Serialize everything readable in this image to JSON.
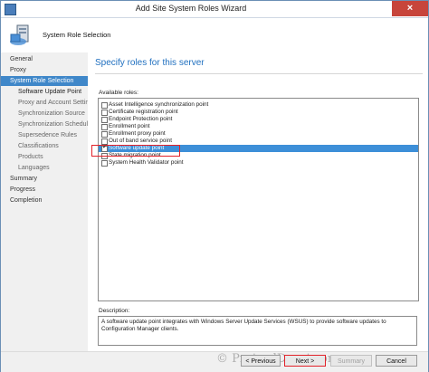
{
  "window": {
    "title": "Add Site System Roles Wizard",
    "close_glyph": "×"
  },
  "header": {
    "title": "System Role Selection"
  },
  "nav": {
    "items": [
      {
        "label": "General",
        "level": 0,
        "selected": false
      },
      {
        "label": "Proxy",
        "level": 0,
        "selected": false
      },
      {
        "label": "System Role Selection",
        "level": 0,
        "selected": true
      },
      {
        "label": "Software Update Point",
        "level": 1,
        "selected": false
      },
      {
        "label": "Proxy and Account Settin",
        "level": 1,
        "selected": false
      },
      {
        "label": "Synchronization Source",
        "level": 1,
        "selected": false
      },
      {
        "label": "Synchronization Schedule",
        "level": 1,
        "selected": false
      },
      {
        "label": "Supersedence Rules",
        "level": 1,
        "selected": false
      },
      {
        "label": "Classifications",
        "level": 1,
        "selected": false
      },
      {
        "label": "Products",
        "level": 1,
        "selected": false
      },
      {
        "label": "Languages",
        "level": 1,
        "selected": false
      },
      {
        "label": "Summary",
        "level": 0,
        "selected": false
      },
      {
        "label": "Progress",
        "level": 0,
        "selected": false
      },
      {
        "label": "Completion",
        "level": 0,
        "selected": false
      }
    ]
  },
  "content": {
    "heading": "Specify roles for this server",
    "available_label": "Available roles:",
    "roles": [
      {
        "label": "Asset Intelligence synchronization point",
        "checked": false,
        "selected": false
      },
      {
        "label": "Certificate registration point",
        "checked": false,
        "selected": false
      },
      {
        "label": "Endpoint Protection point",
        "checked": false,
        "selected": false
      },
      {
        "label": "Enrollment point",
        "checked": false,
        "selected": false
      },
      {
        "label": "Enrollment proxy point",
        "checked": false,
        "selected": false
      },
      {
        "label": "Out of band service point",
        "checked": false,
        "selected": false
      },
      {
        "label": "Software update point",
        "checked": true,
        "selected": true
      },
      {
        "label": "State migration point",
        "checked": false,
        "selected": false
      },
      {
        "label": "System Health Validator point",
        "checked": false,
        "selected": false
      }
    ],
    "description_label": "Description:",
    "description_text": "A software update point integrates with Windows Server Update Services (WSUS) to provide software updates to Configuration Manager clients."
  },
  "footer": {
    "previous_label": "< Previous",
    "next_label": "Next >",
    "summary_label": "Summary",
    "cancel_label": "Cancel"
  },
  "watermark": "© PrajwalDesai.com",
  "colors": {
    "accent": "#3f87c9",
    "heading": "#1f6fbf",
    "highlight": "#e2222a",
    "close": "#c7453b"
  }
}
